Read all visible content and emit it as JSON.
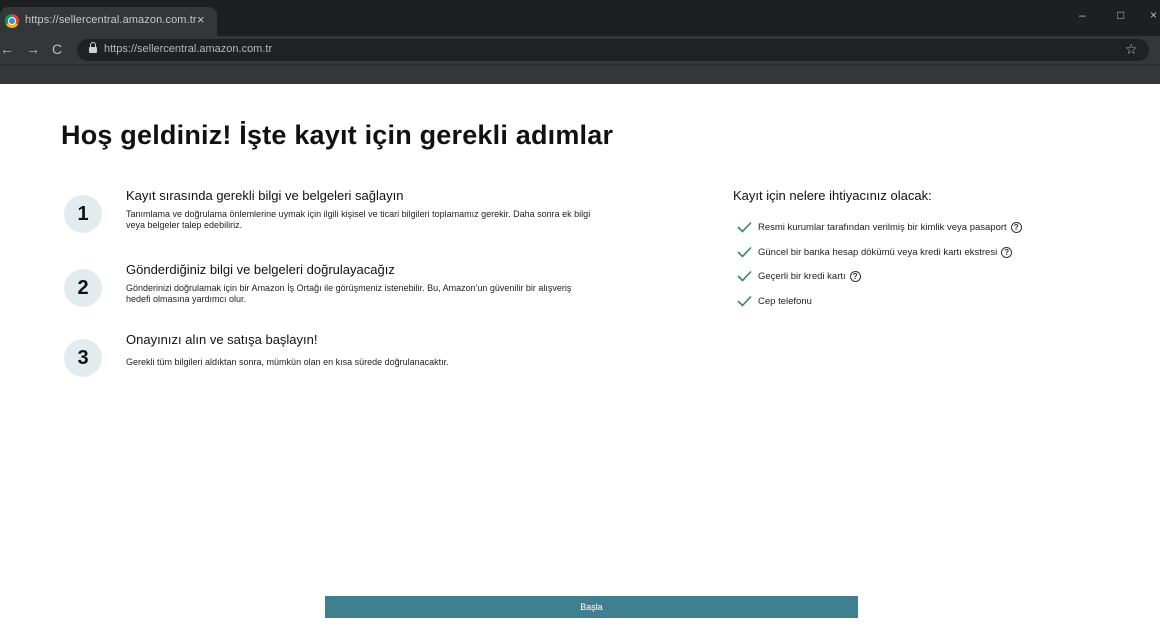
{
  "browser": {
    "tab_title": "https://sellercentral.amazon.com.tr",
    "tab_close": "×",
    "url": "https://sellercentral.amazon.com.tr",
    "back": "←",
    "forward": "→",
    "reload": "C",
    "bookmark": "☆",
    "minimize": "–",
    "maximize": "□",
    "close": "×"
  },
  "page": {
    "title": "Hoş geldiniz! İşte kayıt için gerekli adımlar",
    "steps": [
      {
        "number": "1",
        "title": "Kayıt sırasında gerekli bilgi ve belgeleri sağlayın",
        "description": "Tanımlama ve doğrulama önlemlerine uymak için ilgili kişisel ve ticari bilgileri toplamamız gerekir. Daha sonra ek bilgi veya belgeler talep edebiliriz."
      },
      {
        "number": "2",
        "title": "Gönderdiğiniz bilgi ve belgeleri doğrulayacağız",
        "description": "Gönderinizi doğrulamak için bir Amazon İş Ortağı ile görüşmeniz istenebilir. Bu, Amazon'un güvenilir bir alışveriş hedefi olmasına yardımcı olur."
      },
      {
        "number": "3",
        "title": "Onayınızı alın ve satışa başlayın!",
        "description": "Gerekli tüm bilgileri aldıktan sonra, mümkün olan en kısa sürede doğrulanacaktır."
      }
    ],
    "requirements": {
      "title": "Kayıt için nelere ihtiyacınız olacak:",
      "items": [
        {
          "label": "Resmi kurumlar tarafından verilmiş bir kimlik veya pasaport",
          "help": "?"
        },
        {
          "label": "Güncel bir banka hesap dökümü veya kredi kartı ekstresi",
          "help": "?"
        },
        {
          "label": "Geçerli bir kredi kartı",
          "help": "?"
        },
        {
          "label": "Cep telefonu"
        }
      ]
    },
    "start_button": "Başla"
  },
  "colors": {
    "accent": "#3f7f8f",
    "check": "#2e8b57",
    "step_circle": "#e3ebee"
  }
}
